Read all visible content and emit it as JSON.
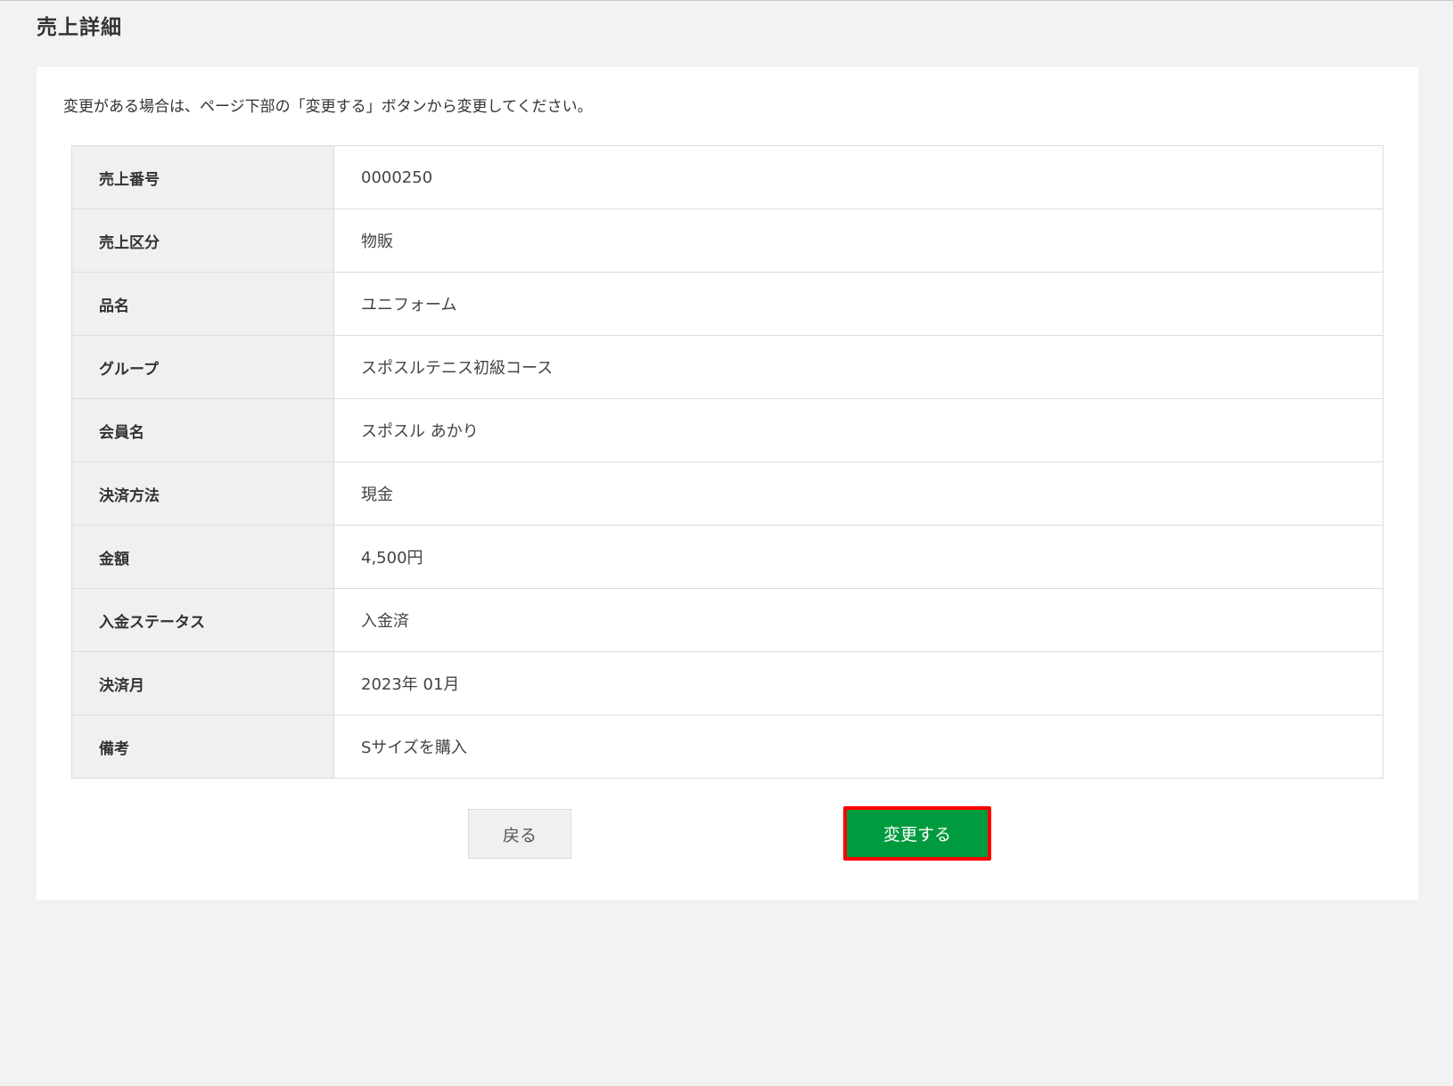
{
  "page": {
    "title": "売上詳細",
    "notice": "変更がある場合は、ページ下部の「変更する」ボタンから変更してください。"
  },
  "details": {
    "rows": [
      {
        "label": "売上番号",
        "value": "0000250"
      },
      {
        "label": "売上区分",
        "value": "物販"
      },
      {
        "label": "品名",
        "value": "ユニフォーム"
      },
      {
        "label": "グループ",
        "value": "スポスルテニス初級コース"
      },
      {
        "label": "会員名",
        "value": "スポスル あかり"
      },
      {
        "label": "決済方法",
        "value": "現金"
      },
      {
        "label": "金額",
        "value": "4,500円"
      },
      {
        "label": "入金ステータス",
        "value": "入金済"
      },
      {
        "label": "決済月",
        "value": "2023年 01月"
      },
      {
        "label": "備考",
        "value": "Sサイズを購入"
      }
    ]
  },
  "actions": {
    "back_label": "戻る",
    "change_label": "変更する"
  },
  "colors": {
    "background": "#f2f2f2",
    "card": "#ffffff",
    "label_cell": "#f0f0f0",
    "primary_button": "#009b3e",
    "highlight_border": "#ff0000"
  }
}
